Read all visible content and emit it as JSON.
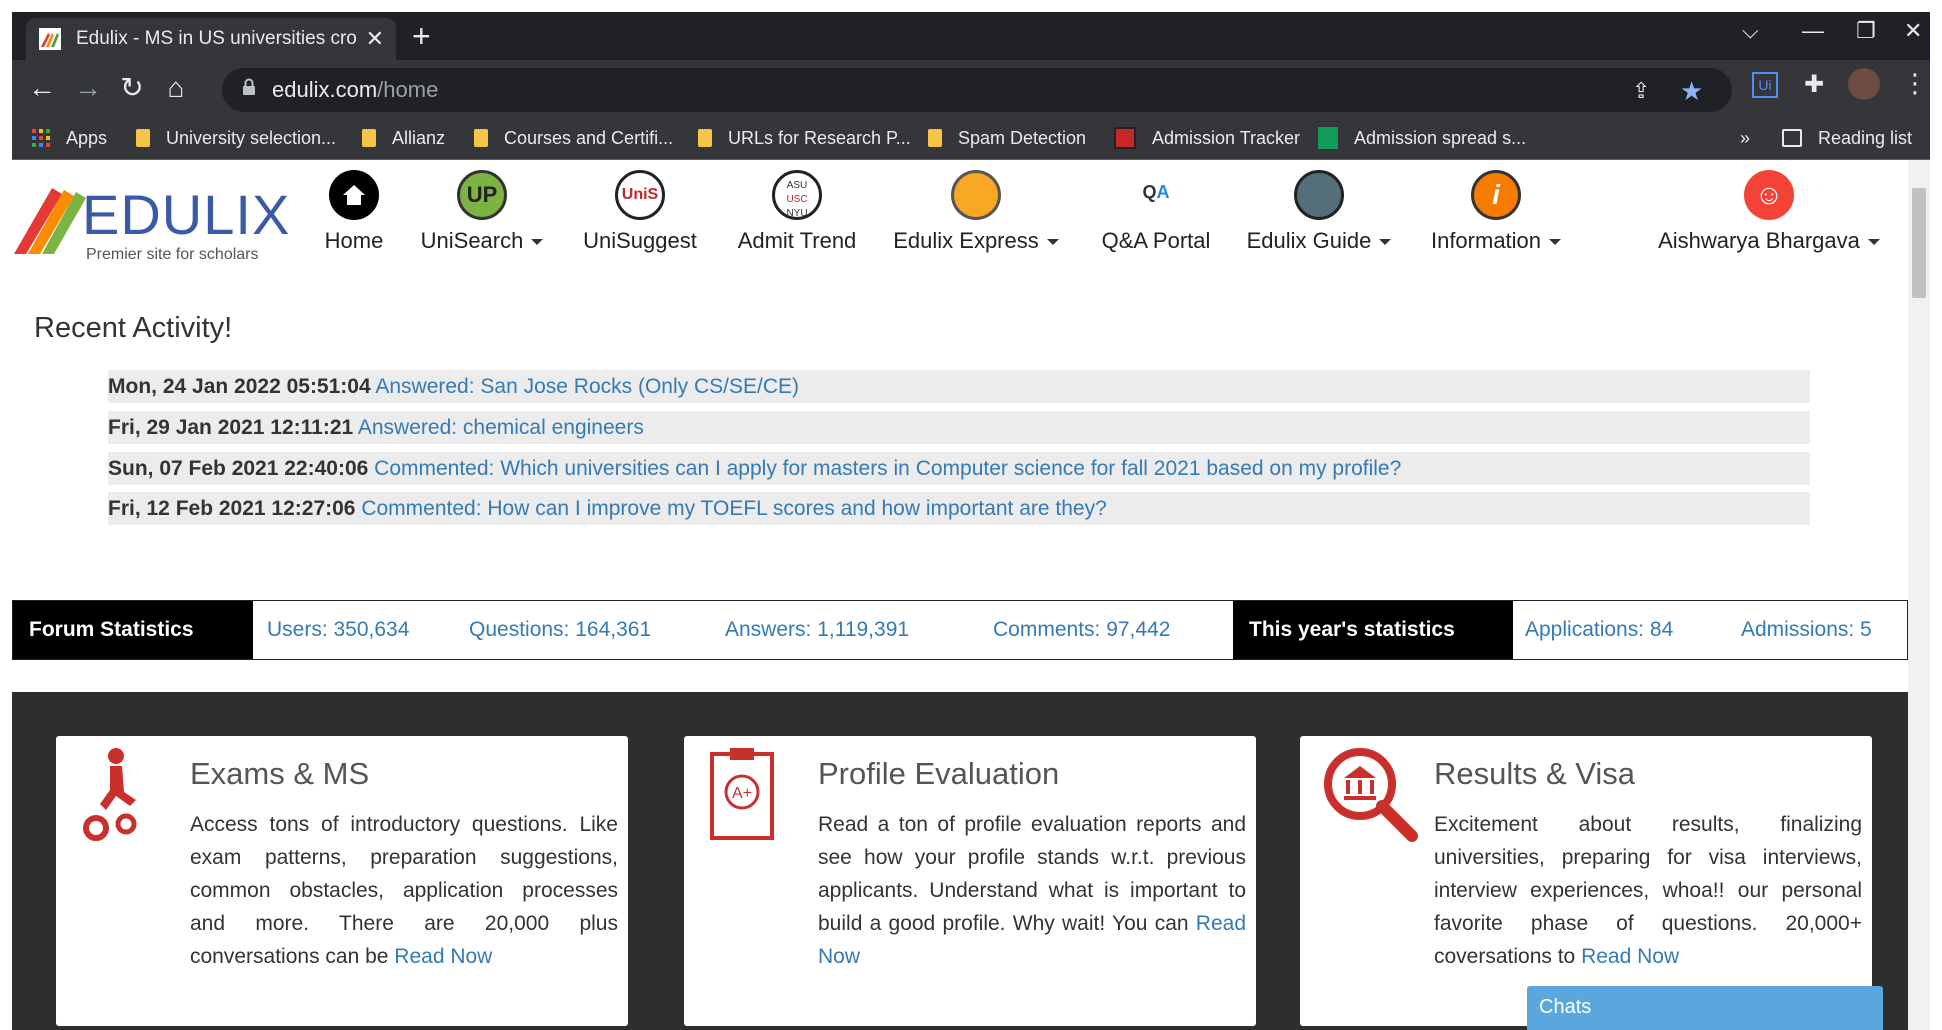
{
  "browser": {
    "tab_title": "Edulix - MS in US universities cro",
    "url_domain": "edulix.com",
    "url_path": "/home",
    "bookmarks": [
      {
        "label": "Apps",
        "icon": "apps-grid-icon"
      },
      {
        "label": "University selection...",
        "icon": "folder-icon"
      },
      {
        "label": "Allianz",
        "icon": "folder-icon"
      },
      {
        "label": "Courses and Certifi...",
        "icon": "folder-icon"
      },
      {
        "label": "URLs for Research P...",
        "icon": "folder-icon"
      },
      {
        "label": "Spam Detection",
        "icon": "folder-icon"
      },
      {
        "label": "Admission Tracker",
        "icon": "red-app-icon"
      },
      {
        "label": "Admission spread s...",
        "icon": "sheets-icon"
      }
    ],
    "overflow": "»",
    "reading_list": "Reading list"
  },
  "site": {
    "logo_word": "EDULIX",
    "logo_tagline": "Premier site for scholars",
    "nav": [
      {
        "label": "Home",
        "icon": "home-icon",
        "dropdown": false
      },
      {
        "label": "UniSearch",
        "icon": "unisearch-icon",
        "dropdown": true
      },
      {
        "label": "UniSuggest",
        "icon": "unisuggest-icon",
        "dropdown": false
      },
      {
        "label": "Admit Trend",
        "icon": "admit-trend-icon",
        "dropdown": false
      },
      {
        "label": "Edulix Express",
        "icon": "express-truck-icon",
        "dropdown": true
      },
      {
        "label": "Q&A Portal",
        "icon": "qa-icon",
        "dropdown": false
      },
      {
        "label": "Edulix Guide",
        "icon": "graduation-cap-icon",
        "dropdown": true
      },
      {
        "label": "Information",
        "icon": "info-icon",
        "dropdown": true
      }
    ],
    "user_name": "Aishwarya Bhargava"
  },
  "recent": {
    "title": "Recent Activity!",
    "items": [
      {
        "ts": "Mon, 24 Jan 2022 05:51:04",
        "text": "Answered: San Jose Rocks (Only CS/SE/CE)"
      },
      {
        "ts": "Fri, 29 Jan 2021 12:11:21",
        "text": "Answered: chemical engineers"
      },
      {
        "ts": "Sun, 07 Feb 2021 22:40:06",
        "text": "Commented: Which universities can I apply for masters in Computer science for fall 2021 based on my profile?"
      },
      {
        "ts": "Fri, 12 Feb 2021 12:27:06",
        "text": "Commented: How can I improve my TOEFL scores and how important are they?"
      }
    ]
  },
  "stats": {
    "forum_label": "Forum Statistics",
    "users": "Users: 350,634",
    "questions": "Questions: 164,361",
    "answers": "Answers: 1,119,391",
    "comments": "Comments: 97,442",
    "year_label": "This year's statistics",
    "applications": "Applications: 84",
    "admissions": "Admissions: 5"
  },
  "cards": [
    {
      "title": "Exams & MS",
      "body": "Access tons of introductory questions. Like exam patterns, preparation suggestions, common obstacles, application processes and more. There are 20,000 plus conversations can be ",
      "link": "Read Now",
      "icon": "climbing-gears-icon"
    },
    {
      "title": "Profile Evaluation",
      "body": "Read a ton of profile evaluation reports and see how your profile stands w.r.t. previous applicants. Understand what is important to build a good profile. Why wait! You can ",
      "link": "Read Now",
      "icon": "clipboard-grade-icon"
    },
    {
      "title": "Results & Visa",
      "body": "Excitement about results, finalizing universities, preparing for visa interviews, interview experiences, whoa!! our personal favorite phase of questions. 20,000+ coversations to ",
      "link": "Read Now",
      "icon": "bank-search-icon"
    }
  ],
  "chats_label": "Chats",
  "colors": {
    "link": "#337ab7",
    "brand": "#3a5aa6",
    "card_icon_red": "#c9302c",
    "chats": "#5aa7e0"
  }
}
